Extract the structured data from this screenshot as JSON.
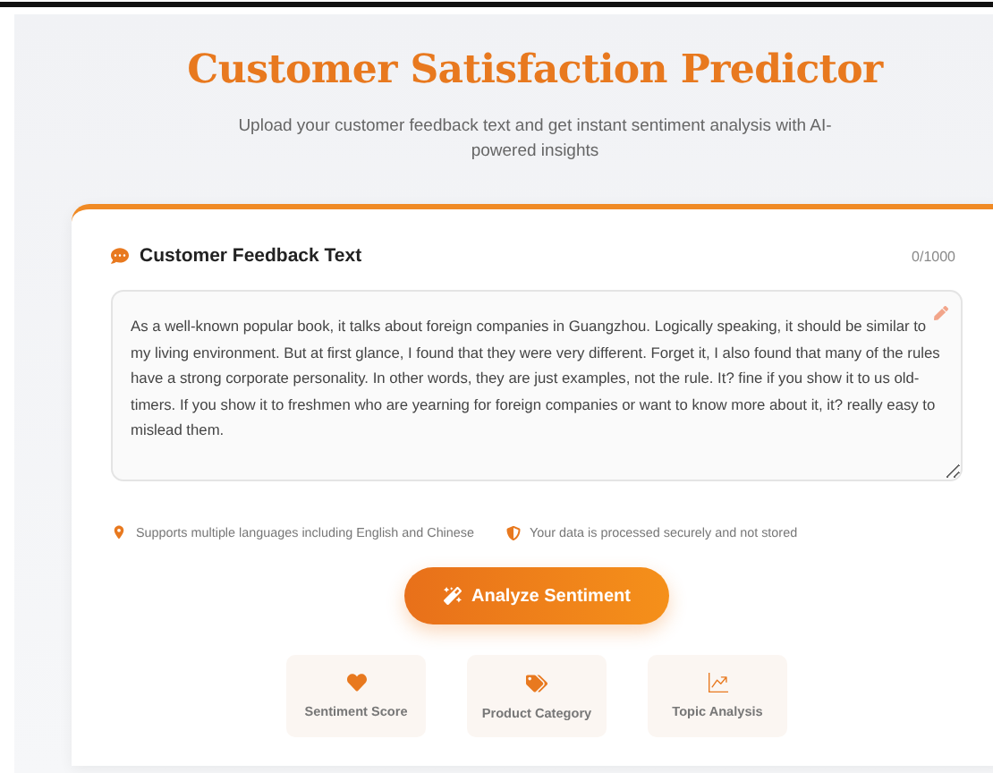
{
  "header": {
    "title": "Customer Satisfaction Predictor",
    "subtitle": "Upload your customer feedback text and get instant sentiment analysis with AI-powered insights"
  },
  "feedback": {
    "label": "Customer Feedback Text",
    "counter": "0/1000",
    "value": "As a well-known popular book, it talks about foreign companies in Guangzhou. Logically speaking, it should be similar to my living environment. But at first glance, I found that they were very different. Forget it, I also found that many of the rules have a strong corporate personality. In other words, they are just examples, not the rule. It? fine if you show it to us old-timers. If you show it to freshmen who are yearning for foreign companies or want to know more about it, it? really easy to mislead them."
  },
  "notes": [
    {
      "kind": "language",
      "text": "Supports multiple languages including English and Chinese"
    },
    {
      "kind": "security",
      "text": "Your data is processed securely and not stored"
    }
  ],
  "analyze_button": "Analyze Sentiment",
  "features": [
    {
      "kind": "heart",
      "label": "Sentiment Score"
    },
    {
      "kind": "tags",
      "label": "Product Category"
    },
    {
      "kind": "chart",
      "label": "Topic Analysis"
    }
  ]
}
